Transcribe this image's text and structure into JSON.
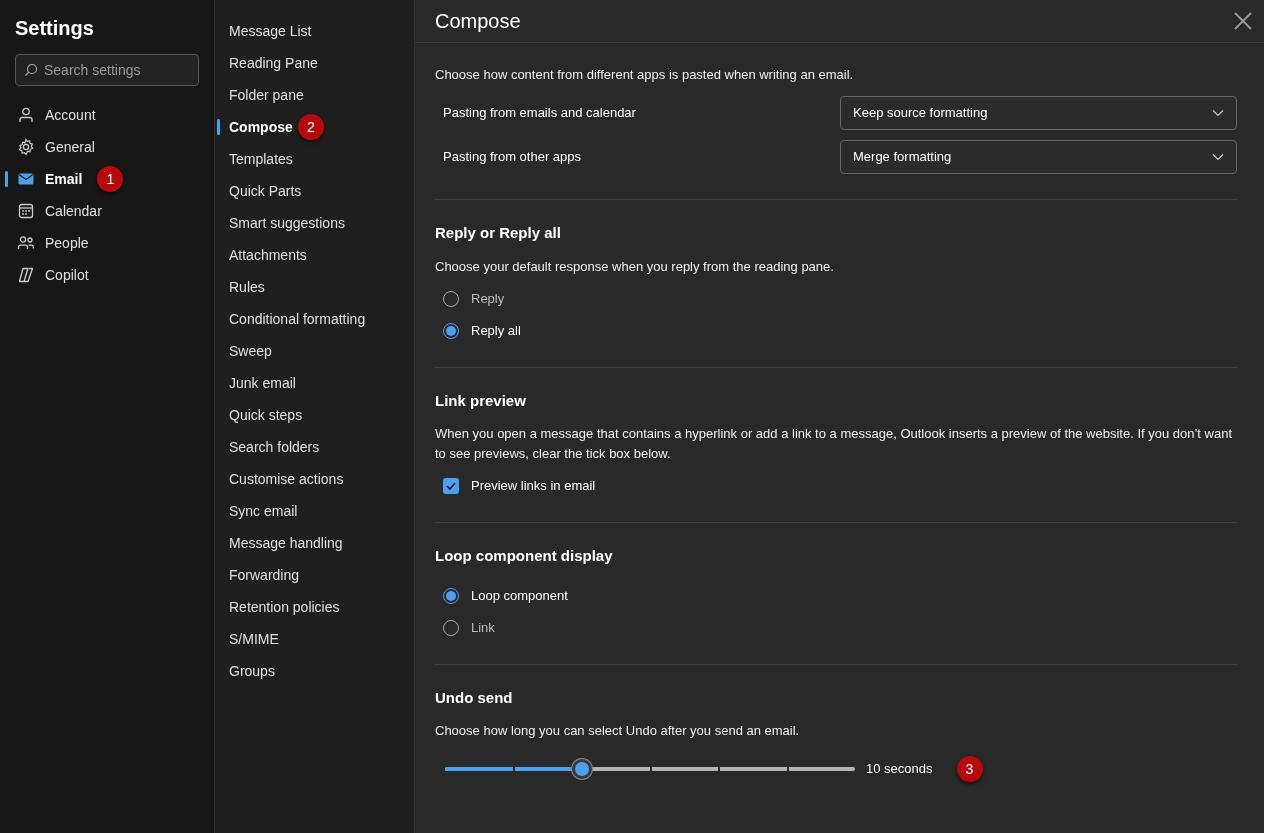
{
  "sidebar": {
    "title": "Settings",
    "search": {
      "placeholder": "Search settings"
    },
    "items": [
      {
        "label": "Account",
        "selected": false
      },
      {
        "label": "General",
        "selected": false
      },
      {
        "label": "Email",
        "selected": true,
        "badge": "1"
      },
      {
        "label": "Calendar",
        "selected": false
      },
      {
        "label": "People",
        "selected": false
      },
      {
        "label": "Copilot",
        "selected": false
      }
    ]
  },
  "subnav": {
    "items": [
      {
        "label": "Message List",
        "selected": false
      },
      {
        "label": "Reading Pane",
        "selected": false
      },
      {
        "label": "Folder pane",
        "selected": false
      },
      {
        "label": "Compose",
        "selected": true,
        "badge": "2"
      },
      {
        "label": "Templates",
        "selected": false
      },
      {
        "label": "Quick Parts",
        "selected": false
      },
      {
        "label": "Smart suggestions",
        "selected": false
      },
      {
        "label": "Attachments",
        "selected": false
      },
      {
        "label": "Rules",
        "selected": false
      },
      {
        "label": "Conditional formatting",
        "selected": false
      },
      {
        "label": "Sweep",
        "selected": false
      },
      {
        "label": "Junk email",
        "selected": false
      },
      {
        "label": "Quick steps",
        "selected": false
      },
      {
        "label": "Search folders",
        "selected": false
      },
      {
        "label": "Customise actions",
        "selected": false
      },
      {
        "label": "Sync email",
        "selected": false
      },
      {
        "label": "Message handling",
        "selected": false
      },
      {
        "label": "Forwarding",
        "selected": false
      },
      {
        "label": "Retention policies",
        "selected": false
      },
      {
        "label": "S/MIME",
        "selected": false
      },
      {
        "label": "Groups",
        "selected": false
      }
    ]
  },
  "panel": {
    "title": "Compose",
    "sections": [
      {
        "description": "Choose how content from different apps is pasted when writing an email.",
        "controls": [
          {
            "kind": "dropdown",
            "label": "Pasting from emails and calendar",
            "value": "Keep source formatting"
          },
          {
            "kind": "dropdown",
            "label": "Pasting from other apps",
            "value": "Merge formatting"
          }
        ]
      },
      {
        "heading": "Reply or Reply all",
        "description": "Choose your default response when you reply from the reading pane.",
        "controls": [
          {
            "kind": "radio",
            "label": "Reply",
            "selected": false
          },
          {
            "kind": "radio",
            "label": "Reply all",
            "selected": true
          }
        ]
      },
      {
        "heading": "Link preview",
        "description": "When you open a message that contains a hyperlink or add a link to a message, Outlook inserts a preview of the website. If you don’t want to see previews, clear the tick box below.",
        "controls": [
          {
            "kind": "checkbox",
            "label": "Preview links in email",
            "checked": true
          }
        ]
      },
      {
        "heading": "Loop component display",
        "controls": [
          {
            "kind": "radio",
            "label": "Loop component",
            "selected": true
          },
          {
            "kind": "radio",
            "label": "Link",
            "selected": false
          }
        ]
      },
      {
        "heading": "Undo send",
        "description": "Choose how long you can select Undo after you send an email.",
        "controls": [
          {
            "kind": "slider",
            "level": 0.3333,
            "reading": "10 seconds",
            "badge": "3"
          }
        ]
      }
    ]
  }
}
